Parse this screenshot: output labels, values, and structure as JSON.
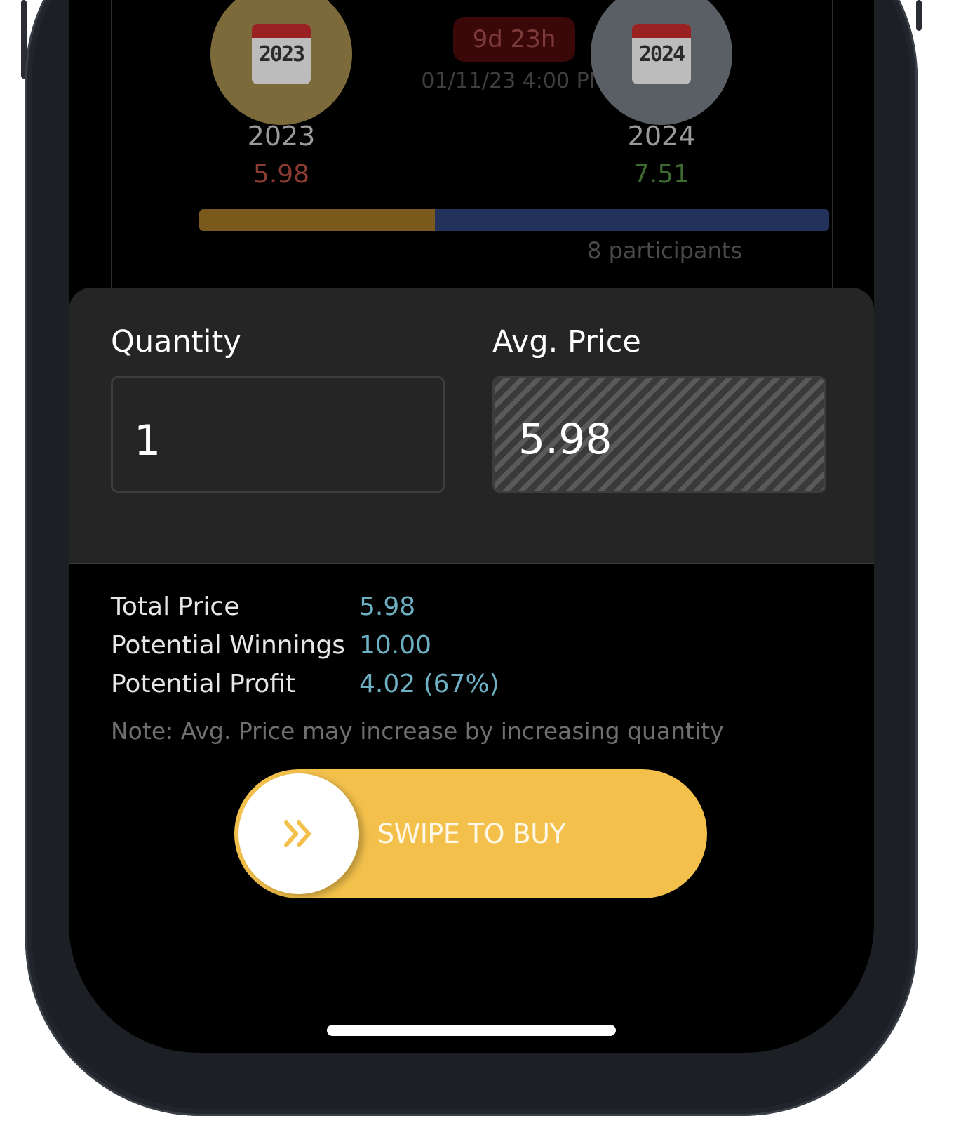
{
  "event": {
    "team_a": {
      "name": "2023",
      "icon_year": "2023",
      "price": "5.98",
      "circle_color": "#7d6a3a",
      "price_color": "#8a3b32"
    },
    "team_b": {
      "name": "2024",
      "icon_year": "2024",
      "price": "7.51",
      "circle_color": "#5a5f66",
      "price_color": "#3d6a2e"
    },
    "countdown": "9d 23h",
    "datetime": "01/11/23 4:00 PM",
    "share_a_fraction": 0.374,
    "participants": "8 participants"
  },
  "order": {
    "quantity_label": "Quantity",
    "quantity_value": "1",
    "avg_price_label": "Avg. Price",
    "avg_price_value": "5.98"
  },
  "summary": {
    "total_price_label": "Total Price",
    "total_price_value": "5.98",
    "winnings_label": "Potential Winnings",
    "winnings_value": "10.00",
    "profit_label": "Potential Profit",
    "profit_value": "4.02 (67%)",
    "note": "Note: Avg. Price may increase by increasing quantity"
  },
  "swipe": {
    "label": "SWIPE TO BUY",
    "icon": "double-chevron-right-icon",
    "color": "#f3c14b"
  }
}
